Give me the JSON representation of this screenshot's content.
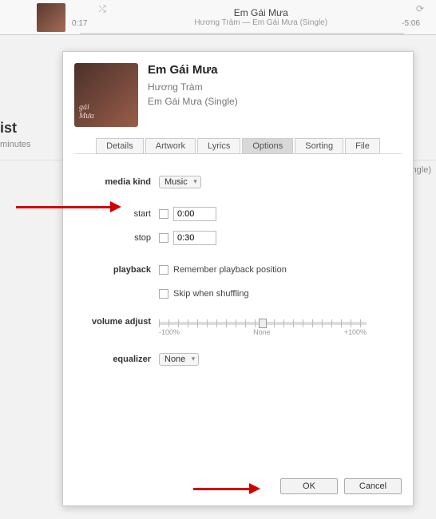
{
  "player": {
    "title": "Em Gái Mưa",
    "subtitle": "Hương Tràm — Em Gái Mưa (Single)",
    "time_elapsed": "0:17",
    "time_remaining": "-5:06"
  },
  "sidebar": {
    "heading": "ist",
    "sub": "minutes"
  },
  "row_visible_album": "a (Single)",
  "dialog": {
    "title": "Em Gái Mưa",
    "artist": "Hương Tràm",
    "album": "Em Gái Mưa (Single)",
    "tabs": {
      "details": "Details",
      "artwork": "Artwork",
      "lyrics": "Lyrics",
      "options": "Options",
      "sorting": "Sorting",
      "file": "File"
    },
    "labels": {
      "media_kind": "media kind",
      "start": "start",
      "stop": "stop",
      "playback": "playback",
      "volume_adjust": "volume adjust",
      "equalizer": "equalizer"
    },
    "media_kind_value": "Music",
    "start_value": "0:00",
    "stop_value": "0:30",
    "playback_remember": "Remember playback position",
    "playback_skip": "Skip when shuffling",
    "slider": {
      "min": "-100%",
      "mid": "None",
      "max": "+100%"
    },
    "equalizer_value": "None",
    "buttons": {
      "ok": "OK",
      "cancel": "Cancel"
    }
  }
}
